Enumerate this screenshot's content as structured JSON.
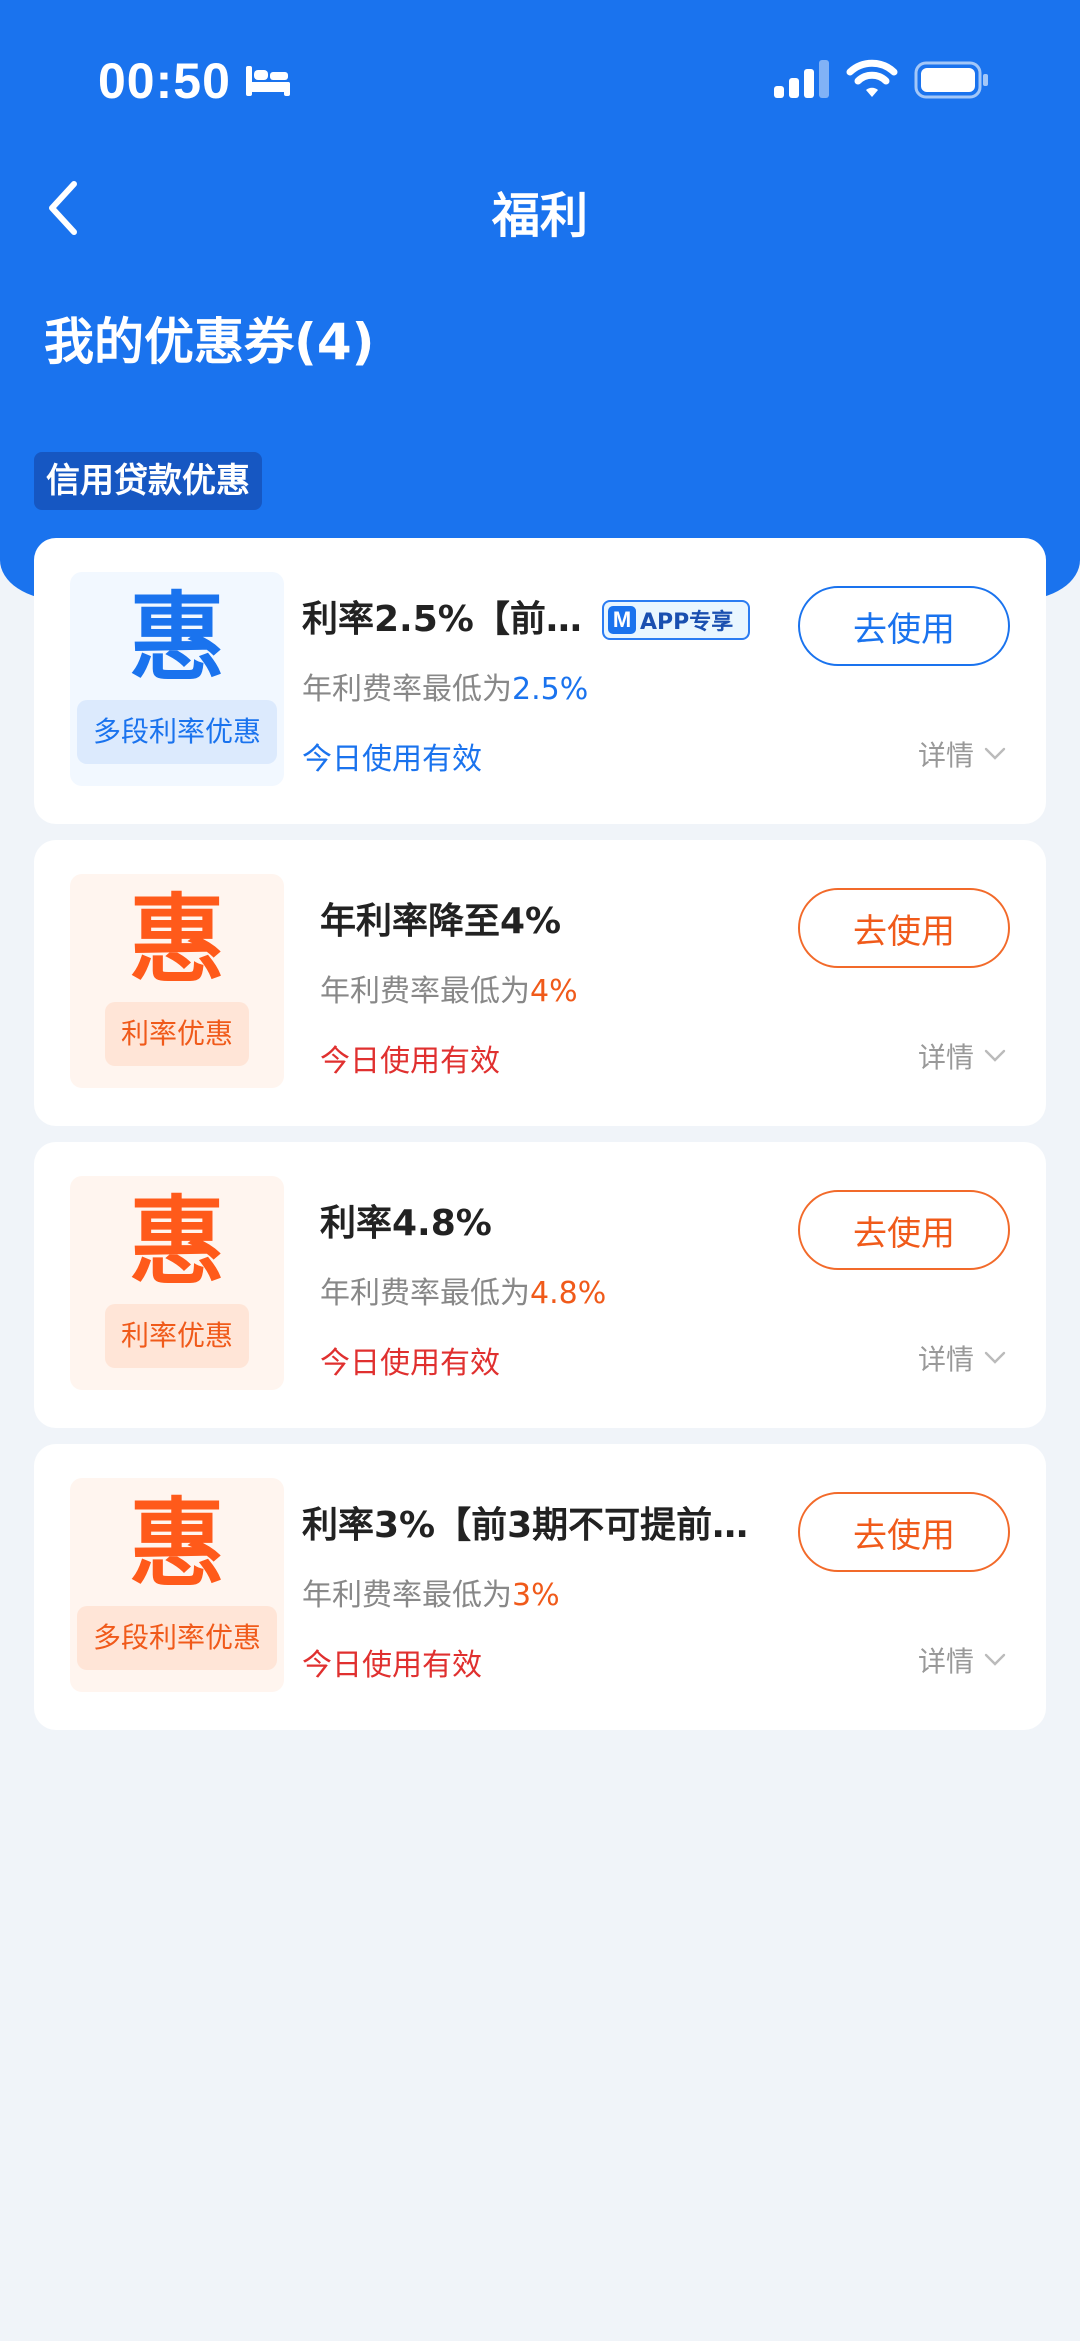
{
  "status_bar": {
    "time": "00:50"
  },
  "nav": {
    "title": "福利"
  },
  "section": {
    "heading": "我的优惠券(4)",
    "category_tag": "信用贷款优惠"
  },
  "colors": {
    "primary": "#1a73ee",
    "orange": "#f05a1a",
    "red": "#e0302f",
    "background": "#f0f4f9"
  },
  "coupons": [
    {
      "badge_char": "惠",
      "badge_label": "多段利率优惠",
      "title": "利率2.5%【前…",
      "app_tag": "APP专享",
      "rate_prefix": "年利费率最低为",
      "rate_value": "2.5%",
      "validity": "今日使用有效",
      "button_label": "去使用",
      "details_label": "详情",
      "theme": "blue"
    },
    {
      "badge_char": "惠",
      "badge_label": "利率优惠",
      "title": "年利率降至4%",
      "rate_prefix": "年利费率最低为",
      "rate_value": "4%",
      "validity": "今日使用有效",
      "button_label": "去使用",
      "details_label": "详情",
      "theme": "orange"
    },
    {
      "badge_char": "惠",
      "badge_label": "利率优惠",
      "title": "利率4.8%",
      "rate_prefix": "年利费率最低为",
      "rate_value": "4.8%",
      "validity": "今日使用有效",
      "button_label": "去使用",
      "details_label": "详情",
      "theme": "orange"
    },
    {
      "badge_char": "惠",
      "badge_label": "多段利率优惠",
      "title": "利率3%【前3期不可提前…",
      "rate_prefix": "年利费率最低为",
      "rate_value": "3%",
      "validity": "今日使用有效",
      "button_label": "去使用",
      "details_label": "详情",
      "theme": "orange"
    }
  ]
}
